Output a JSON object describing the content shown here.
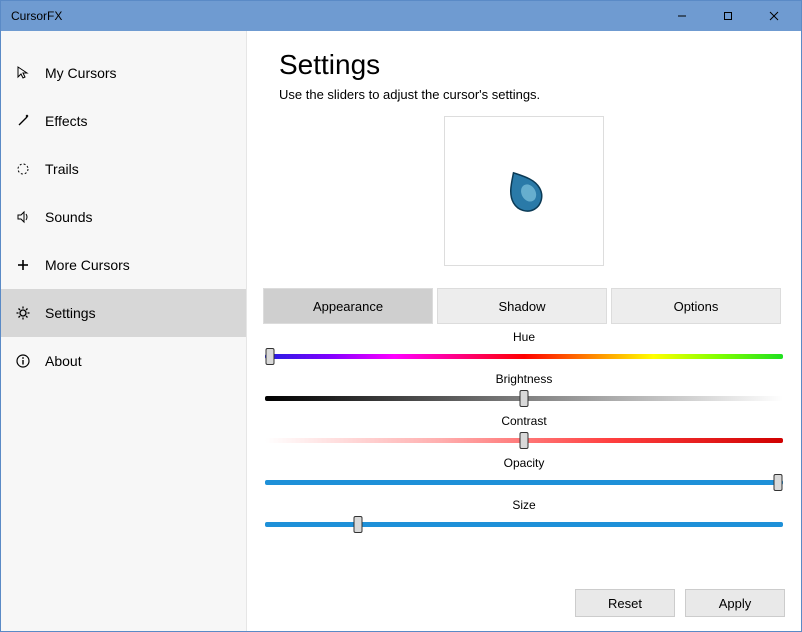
{
  "window": {
    "title": "CursorFX"
  },
  "sidebar": {
    "items": [
      {
        "label": "My Cursors"
      },
      {
        "label": "Effects"
      },
      {
        "label": "Trails"
      },
      {
        "label": "Sounds"
      },
      {
        "label": "More Cursors"
      },
      {
        "label": "Settings"
      },
      {
        "label": "About"
      }
    ],
    "activeIndex": 5
  },
  "page": {
    "title": "Settings",
    "subtitle": "Use the sliders to adjust the cursor's settings."
  },
  "tabs": {
    "items": [
      {
        "label": "Appearance"
      },
      {
        "label": "Shadow"
      },
      {
        "label": "Options"
      }
    ],
    "activeIndex": 0
  },
  "sliders": {
    "hue": {
      "label": "Hue",
      "valuePct": 1
    },
    "brightness": {
      "label": "Brightness",
      "valuePct": 50
    },
    "contrast": {
      "label": "Contrast",
      "valuePct": 50
    },
    "opacity": {
      "label": "Opacity",
      "valuePct": 99
    },
    "size": {
      "label": "Size",
      "valuePct": 18
    }
  },
  "buttons": {
    "reset": "Reset",
    "apply": "Apply"
  }
}
